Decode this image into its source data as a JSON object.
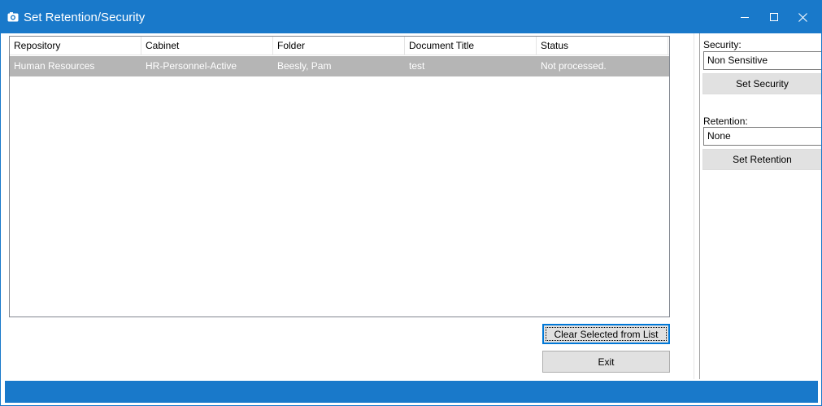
{
  "window": {
    "title": "Set Retention/Security",
    "controls": {
      "minimize_icon": "minimize-icon",
      "maximize_icon": "maximize-icon",
      "close_icon": "close-icon"
    }
  },
  "list": {
    "columns": [
      "Repository",
      "Cabinet",
      "Folder",
      "Document Title",
      "Status"
    ],
    "rows": [
      [
        "Human Resources",
        "HR-Personnel-Active",
        "Beesly, Pam",
        "test",
        "Not processed."
      ]
    ]
  },
  "buttons": {
    "clear_selected": "Clear Selected from List",
    "exit": "Exit"
  },
  "side": {
    "security_label": "Security:",
    "security_value": "Non Sensitive",
    "set_security": "Set Security",
    "retention_label": "Retention:",
    "retention_value": "None",
    "set_retention": "Set Retention"
  },
  "colors": {
    "accent": "#1979ca",
    "selected_row": "#b5b5b5"
  }
}
